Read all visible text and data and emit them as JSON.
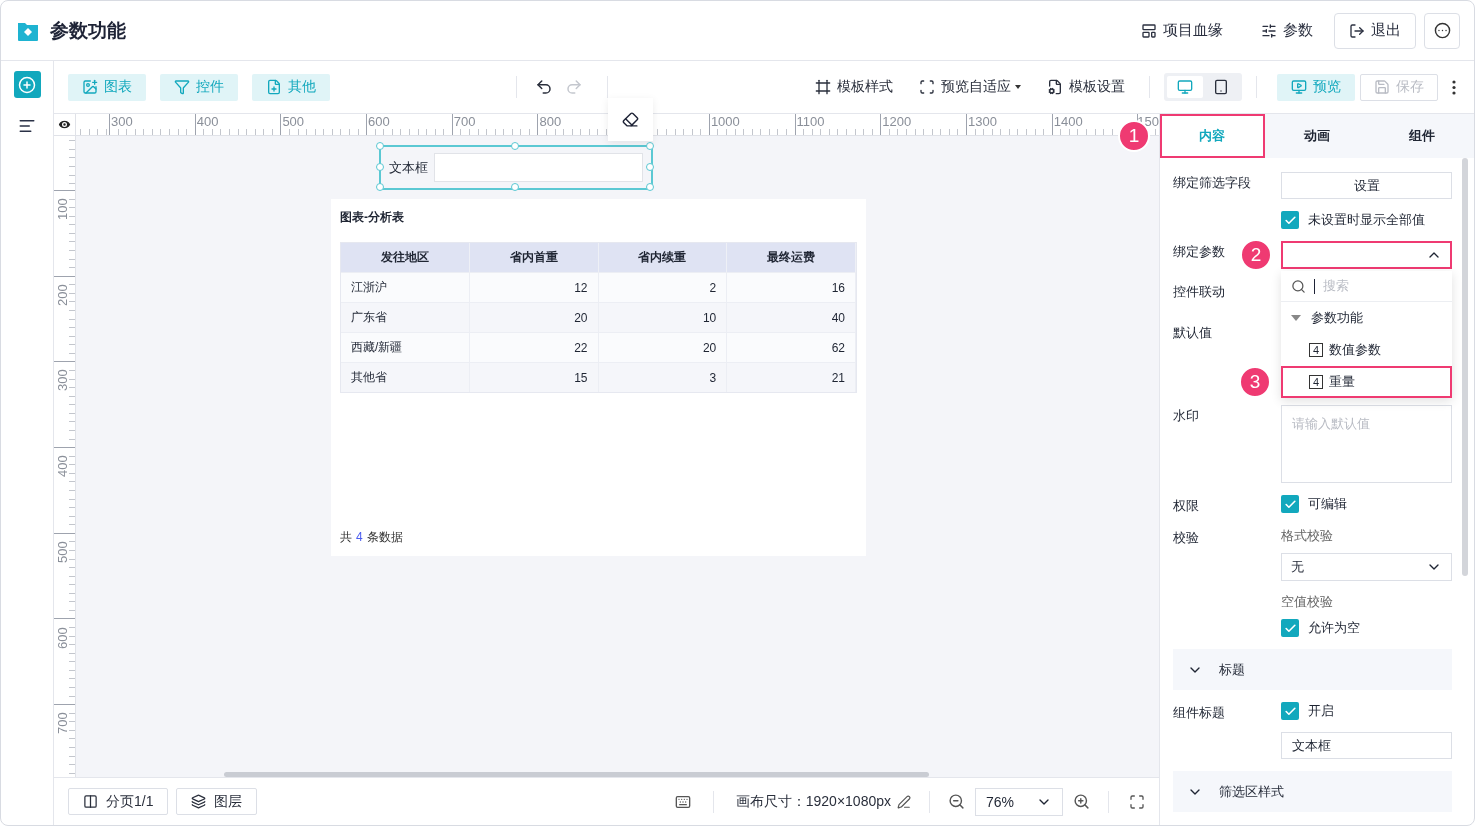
{
  "header": {
    "title": "参数功能",
    "actions": [
      {
        "label": "项目血缘",
        "outlined": false
      },
      {
        "label": "参数",
        "outlined": false
      },
      {
        "label": "退出",
        "outlined": true
      }
    ]
  },
  "rail": [
    {
      "selected": true
    },
    {
      "selected": false
    }
  ],
  "toolbar": {
    "add_buttons": [
      "图表",
      "控件",
      "其他"
    ],
    "history": [
      {
        "disabled": false
      },
      {
        "disabled": true
      }
    ],
    "tools": [
      {
        "label": "模板样式",
        "dropdown": false
      },
      {
        "label": "预览自适应",
        "dropdown": true
      },
      {
        "label": "模板设置",
        "dropdown": false
      }
    ],
    "devices": [
      {
        "selected": true
      },
      {
        "selected": false
      }
    ],
    "preview": "预览",
    "save": {
      "label": "保存",
      "disabled": true
    }
  },
  "ruler": {
    "x_labels": [
      "300",
      "400",
      "500",
      "600",
      "700",
      "800",
      "1000",
      "1100",
      "1200",
      "1300",
      "1400",
      "150"
    ],
    "y_labels": [
      "100",
      "200",
      "300",
      "400",
      "500",
      "600",
      "700"
    ]
  },
  "canvas": {
    "widget": {
      "label": "文本框",
      "selected": true
    },
    "card": {
      "title": "图表-分析表",
      "columns": [
        "发往地区",
        "省内首重",
        "省内续重",
        "最终运费"
      ],
      "rows": [
        [
          "江浙沪",
          "12",
          "2",
          "16"
        ],
        [
          "广东省",
          "20",
          "10",
          "40"
        ],
        [
          "西藏/新疆",
          "22",
          "20",
          "62"
        ],
        [
          "其他省",
          "15",
          "3",
          "21"
        ]
      ],
      "footer": {
        "prefix": "共",
        "count": "4",
        "suffix": "条数据"
      }
    }
  },
  "footer": {
    "pages": "分页1/1",
    "layers": "图层",
    "canvas_size": "画布尺寸：1920×1080px",
    "zoom": "76%"
  },
  "panel": {
    "tabs": [
      {
        "label": "内容",
        "selected": true,
        "highlighted": true,
        "badge": "1"
      },
      {
        "label": "动画",
        "selected": false,
        "highlighted": false
      },
      {
        "label": "组件",
        "selected": false,
        "highlighted": false
      }
    ],
    "rows": [
      {
        "kind": "field",
        "label": "绑定筛选字段",
        "controls": [
          {
            "kind": "button",
            "label": "设置"
          },
          {
            "kind": "checkbox",
            "label": "未设置时显示全部值",
            "checked": true
          }
        ]
      },
      {
        "kind": "field",
        "label": "绑定参数",
        "controls": [
          {
            "kind": "select",
            "open": true,
            "highlighted": true,
            "badge": "2",
            "menu": {
              "search_placeholder": "搜索",
              "groups": [
                {
                  "label": "参数功能",
                  "expanded": true,
                  "children": [
                    {
                      "label": "数值参数",
                      "type_mark": "4",
                      "highlighted": false
                    },
                    {
                      "label": "重量",
                      "type_mark": "4",
                      "highlighted": true,
                      "badge": "3"
                    }
                  ]
                }
              ]
            }
          }
        ]
      },
      {
        "kind": "field",
        "label": "控件联动"
      },
      {
        "kind": "field",
        "label": "默认值"
      },
      {
        "kind": "field",
        "label": "水印",
        "controls": [
          {
            "kind": "textarea",
            "placeholder": "请输入默认值"
          }
        ]
      },
      {
        "kind": "field",
        "label": "权限",
        "controls": [
          {
            "kind": "checkbox",
            "label": "可编辑",
            "checked": true
          }
        ]
      },
      {
        "kind": "field",
        "label": "校验",
        "controls": [
          {
            "kind": "caption",
            "label": "格式校验"
          },
          {
            "kind": "select",
            "value": "无",
            "open": false,
            "highlighted": false
          },
          {
            "kind": "caption",
            "label": "空值校验"
          },
          {
            "kind": "checkbox",
            "label": "允许为空",
            "checked": true
          }
        ]
      },
      {
        "kind": "section",
        "label": "标题",
        "expanded": true
      },
      {
        "kind": "field",
        "label": "组件标题",
        "controls": [
          {
            "kind": "checkbox",
            "label": "开启",
            "checked": true
          },
          {
            "kind": "input",
            "value": "文本框"
          }
        ]
      },
      {
        "kind": "section",
        "label": "筛选区样式",
        "expanded": true
      }
    ]
  }
}
